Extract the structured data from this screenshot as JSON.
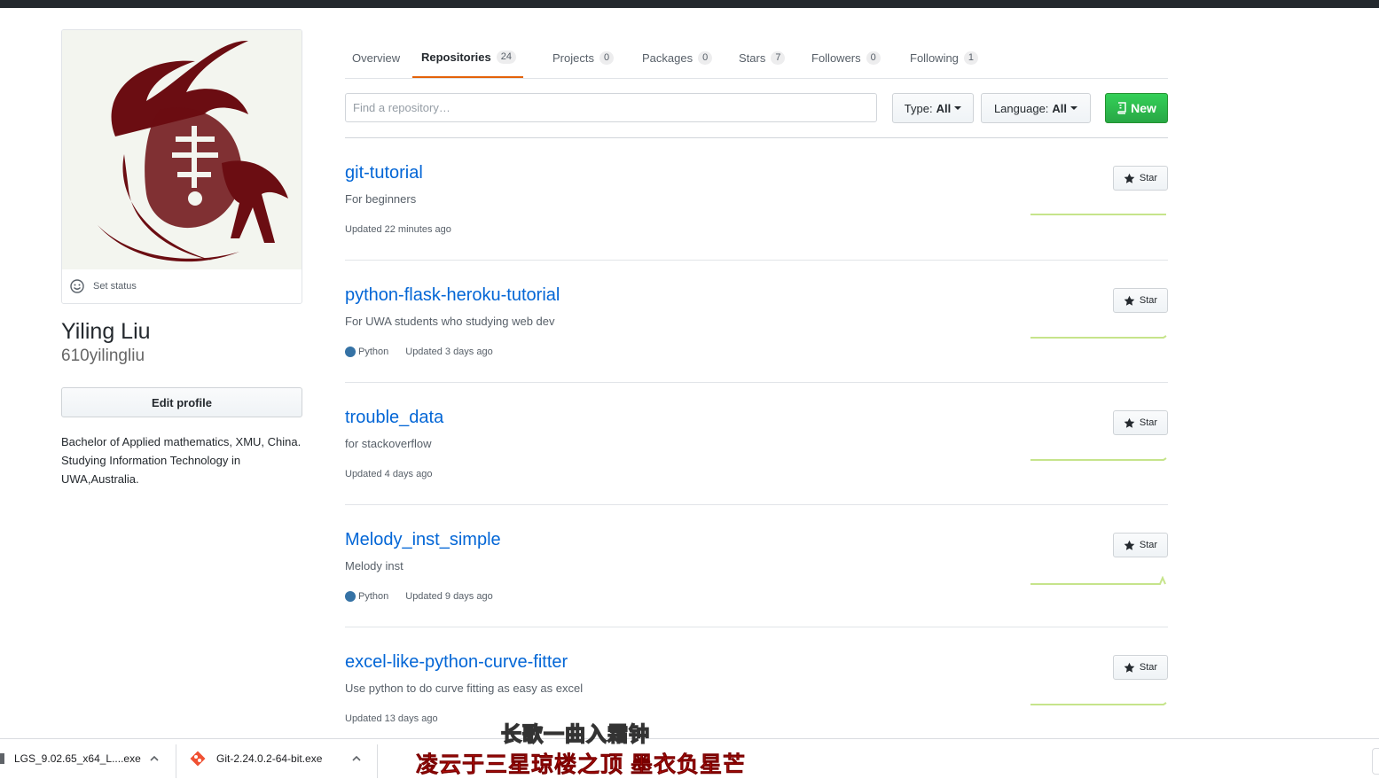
{
  "profile": {
    "set_status": "Set status",
    "full_name": "Yiling Liu",
    "username": "610yilingliu",
    "edit_profile": "Edit profile",
    "bio": "Bachelor of Applied mathematics, XMU, China. Studying Information Technology in UWA,Australia."
  },
  "tabs": [
    {
      "label": "Overview",
      "count": ""
    },
    {
      "label": "Repositories",
      "count": "24"
    },
    {
      "label": "Projects",
      "count": "0"
    },
    {
      "label": "Packages",
      "count": "0"
    },
    {
      "label": "Stars",
      "count": "7"
    },
    {
      "label": "Followers",
      "count": "0"
    },
    {
      "label": "Following",
      "count": "1"
    }
  ],
  "filters": {
    "search_placeholder": "Find a repository…",
    "type_label": "Type:",
    "type_value": "All",
    "language_label": "Language:",
    "language_value": "All",
    "new_label": "New"
  },
  "repos": [
    {
      "name": "git-tutorial",
      "description": "For beginners",
      "language": "",
      "updated": "Updated 22 minutes ago",
      "star_label": "Star"
    },
    {
      "name": "python-flask-heroku-tutorial",
      "description": "For UWA students who studying web dev",
      "language": "Python",
      "updated": "Updated 3 days ago",
      "star_label": "Star"
    },
    {
      "name": "trouble_data",
      "description": "for stackoverflow",
      "language": "",
      "updated": "Updated 4 days ago",
      "star_label": "Star"
    },
    {
      "name": "Melody_inst_simple",
      "description": "Melody inst",
      "language": "Python",
      "updated": "Updated 9 days ago",
      "star_label": "Star"
    },
    {
      "name": "excel-like-python-curve-fitter",
      "description": "Use python to do curve fitting as easy as excel",
      "language": "",
      "updated": "Updated 13 days ago",
      "star_label": "Star"
    }
  ],
  "colors": {
    "link": "#0366d6",
    "python": "#3572a5",
    "accent_tab": "#e36209",
    "new_button": "#28a745",
    "sparkline": "#c6e48b"
  },
  "subtitles": {
    "line1": "长歌一曲入霜钟",
    "line2": "凌云于三星琼楼之顶 墨衣负星芒"
  },
  "downloads": [
    {
      "filename": "LGS_9.02.65_x64_L....exe"
    },
    {
      "filename": "Git-2.24.0.2-64-bit.exe"
    }
  ]
}
